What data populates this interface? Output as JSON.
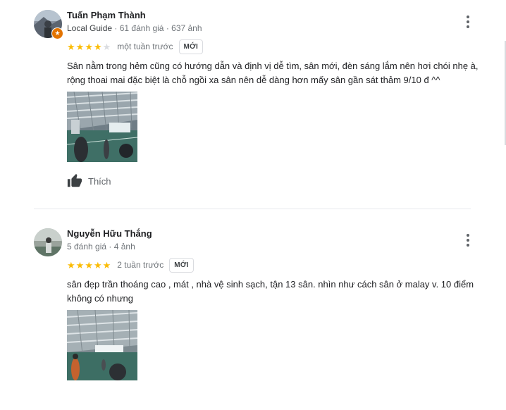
{
  "reviews": [
    {
      "reviewer_name": "Tuấn Phạm Thành",
      "local_guide_label": "Local Guide",
      "review_count": "61 đánh giá",
      "photo_count": "637 ảnh",
      "separator": "·",
      "rating": 4,
      "max_rating": 5,
      "time_ago": "một tuần trước",
      "new_badge": "MỚI",
      "text": "Sân nằm trong hẻm cũng có hướng dẫn và định vị dễ tìm, sân mới, đèn sáng lắm nên hơi chói nhẹ à, rộng thoai mai đặc biệt là chỗ ngồi xa sân nên dễ dàng hơn mấy sân gần sát thảm 9/10 đ ^^",
      "like_label": "Thích"
    },
    {
      "reviewer_name": "Nguyễn Hữu Thắng",
      "review_count": "5 đánh giá",
      "photo_count": "4 ảnh",
      "separator": "·",
      "rating": 5,
      "max_rating": 5,
      "time_ago": "2 tuần trước",
      "new_badge": "MỚI",
      "text": "sân đẹp trần thoáng cao , mát , nhà vệ sinh sạch, tận 13 sân.  nhìn như cách sân ở malay v. 10 điểm không có  nhưng"
    }
  ],
  "icons": {
    "more_options": "more-vert-icon",
    "like": "thumb-up-icon",
    "local_guide": "local-guide-badge-icon",
    "star_filled": "★",
    "star_empty": "★"
  },
  "colors": {
    "star_filled": "#fbbc04",
    "star_empty": "#dadce0",
    "meta_text": "#70757a",
    "local_guide_badge": "#e37400",
    "divider": "#e8eaed"
  }
}
